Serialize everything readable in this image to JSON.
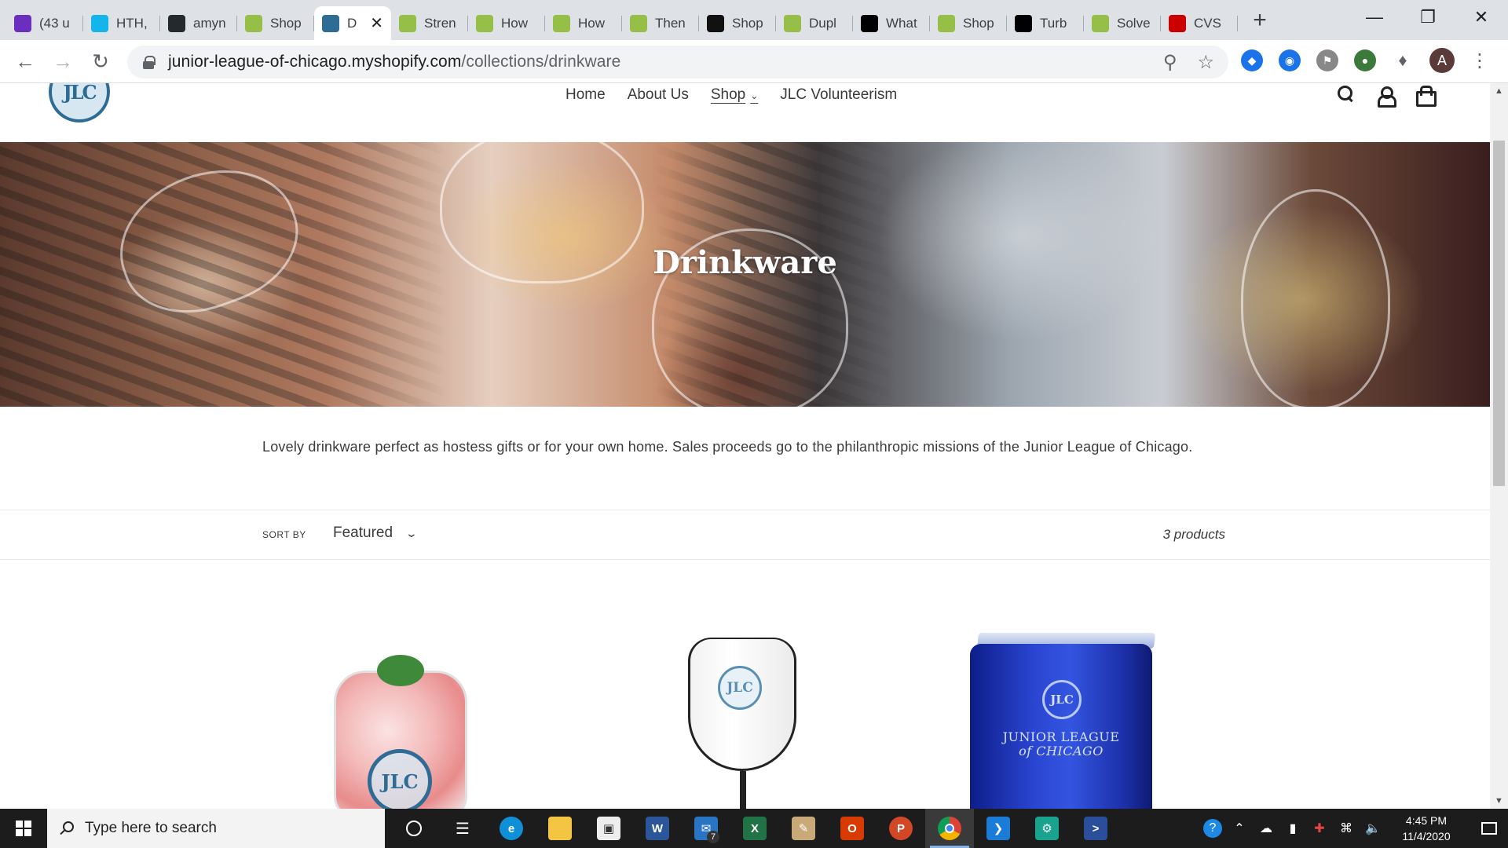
{
  "browser": {
    "tabs": [
      {
        "title": "(43 u",
        "favicon": "mail-icon",
        "color": "#6b2fbf"
      },
      {
        "title": "HTH,",
        "favicon": "xero-icon",
        "color": "#13b5ea"
      },
      {
        "title": "amyn",
        "favicon": "github-icon",
        "color": "#24292e"
      },
      {
        "title": "Shop",
        "favicon": "shopify-icon",
        "color": "#95bf47"
      },
      {
        "title": "D",
        "favicon": "jlc-icon",
        "color": "#2e6b95",
        "active": true
      },
      {
        "title": "Stren",
        "favicon": "shopify-icon",
        "color": "#95bf47"
      },
      {
        "title": "How",
        "favicon": "shopify-icon",
        "color": "#95bf47"
      },
      {
        "title": "How",
        "favicon": "shopify-icon",
        "color": "#95bf47"
      },
      {
        "title": "Then",
        "favicon": "shopify-icon",
        "color": "#95bf47"
      },
      {
        "title": "Shop",
        "favicon": "sk-icon",
        "color": "#111111"
      },
      {
        "title": "Dupl",
        "favicon": "shopify-icon",
        "color": "#95bf47"
      },
      {
        "title": "What",
        "favicon": "square-icon",
        "color": "#000000"
      },
      {
        "title": "Shop",
        "favicon": "shopify-icon",
        "color": "#95bf47"
      },
      {
        "title": "Turb",
        "favicon": "square-icon",
        "color": "#000000"
      },
      {
        "title": "Solve",
        "favicon": "shopify-icon",
        "color": "#95bf47"
      },
      {
        "title": "CVS",
        "favicon": "heart-icon",
        "color": "#cc0000"
      }
    ],
    "active_tab_close": "✕",
    "new_tab": "+",
    "url_domain": "junior-league-of-chicago.myshopify.com",
    "url_path": "/collections/drinkware",
    "profile_initial": "A"
  },
  "site": {
    "logo_text": "JLC",
    "nav": [
      {
        "label": "Home"
      },
      {
        "label": "About Us"
      },
      {
        "label": "Shop",
        "has_dropdown": true,
        "current": true
      },
      {
        "label": "JLC Volunteerism"
      }
    ],
    "nav_caret": "⌄"
  },
  "collection": {
    "title": "Drinkware",
    "description": "Lovely drinkware perfect as hostess gifts or for your own home. Sales proceeds go to the philanthropic missions of the Junior League of Chicago.",
    "sort_label": "SORT BY",
    "sort_value": "Featured",
    "product_count": "3 products"
  },
  "products": [
    {
      "badge": "JLC"
    },
    {
      "badge": "JLC"
    },
    {
      "badge": "JLC",
      "brand_line1": "JUNIOR LEAGUE",
      "brand_line2": "of CHICAGO"
    }
  ],
  "taskbar": {
    "search_placeholder": "Type here to search",
    "mail_badge": "7",
    "time": "4:45 PM",
    "date": "11/4/2020"
  }
}
